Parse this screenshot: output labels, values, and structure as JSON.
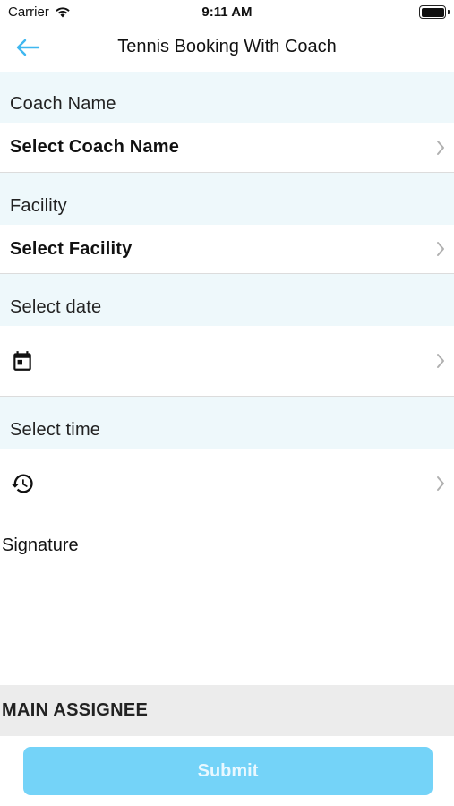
{
  "status_bar": {
    "carrier": "Carrier",
    "time": "9:11 AM"
  },
  "nav": {
    "title": "Tennis Booking With Coach",
    "back_icon": "arrow-left-icon"
  },
  "colors": {
    "accent": "#3fb7f0",
    "section_bg": "#eef8fb",
    "submit_bg": "#74d3f8",
    "assignee_bg": "#ececec"
  },
  "form": {
    "coach": {
      "label": "Coach Name",
      "value": "Select Coach Name"
    },
    "facility": {
      "label": "Facility",
      "value": "Select Facility"
    },
    "date": {
      "label": "Select date",
      "icon": "calendar-icon"
    },
    "time": {
      "label": "Select time",
      "icon": "history-icon"
    },
    "signature": {
      "label": "Signature"
    },
    "assignee": {
      "label": "MAIN ASSIGNEE"
    },
    "submit": {
      "label": "Submit"
    }
  }
}
